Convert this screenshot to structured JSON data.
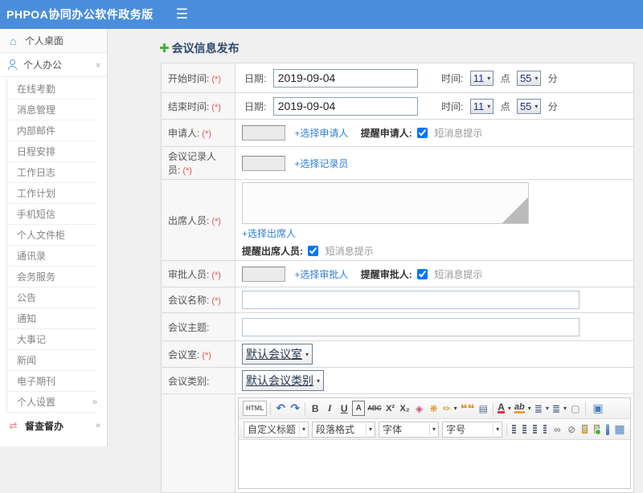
{
  "header": {
    "title": "PHPOA协同办公软件政务版"
  },
  "icons": {
    "menu": "☰",
    "home": "⌂",
    "chevron": "»",
    "plus": "✚",
    "shuffle": "⇄",
    "arrow": "▾"
  },
  "sidebar": {
    "desktop": "个人桌面",
    "office": "个人办公",
    "submenu": [
      "在线考勤",
      "消息管理",
      "内部邮件",
      "日程安排",
      "工作日志",
      "工作计划",
      "手机短信",
      "个人文件柜",
      "通讯录",
      "会务服务",
      "公告",
      "通知",
      "大事记",
      "新闻",
      "电子期刊"
    ],
    "settings": "个人设置",
    "supervision": "督查督办"
  },
  "page_title": "会议信息发布",
  "form": {
    "start_time": {
      "label": "开始时间:",
      "req": "(*)",
      "date_label": "日期:",
      "date": "2019-09-04",
      "time_label": "时间:",
      "hour": "11",
      "hour_unit": "点",
      "minute": "55",
      "minute_unit": "分"
    },
    "end_time": {
      "label": "结束时间:",
      "req": "(*)",
      "date_label": "日期:",
      "date": "2019-09-04",
      "time_label": "时间:",
      "hour": "11",
      "hour_unit": "点",
      "minute": "55",
      "minute_unit": "分"
    },
    "applicant": {
      "label": "申请人:",
      "req": "(*)",
      "link": "+选择申请人",
      "remind": "提醒申请人:",
      "sms": "短消息提示",
      "checked": "checked"
    },
    "recorder": {
      "label": "会议记录人员:",
      "req": "(*)",
      "link": "+选择记录员"
    },
    "attendees": {
      "label": "出席人员:",
      "req": "(*)",
      "link": "+选择出席人",
      "remind": "提醒出席人员:",
      "sms": "短消息提示",
      "checked": "checked"
    },
    "approver": {
      "label": "审批人员:",
      "req": "(*)",
      "link": "+选择审批人",
      "remind": "提醒审批人:",
      "sms": "短消息提示",
      "checked": "checked"
    },
    "name": {
      "label": "会议名称:",
      "req": "(*)"
    },
    "topic": {
      "label": "会议主题:"
    },
    "room": {
      "label": "会议室:",
      "req": "(*)",
      "value": "默认会议室"
    },
    "category": {
      "label": "会议类别:",
      "value": "默认会议类别"
    }
  },
  "editor": {
    "row1": [
      {
        "n": "html-source",
        "g": "HTML"
      },
      {
        "n": "undo",
        "g": "↶"
      },
      {
        "n": "redo",
        "g": "↷"
      },
      {
        "n": "bold",
        "g": "B"
      },
      {
        "n": "italic",
        "g": "I"
      },
      {
        "n": "underline",
        "g": "U"
      },
      {
        "n": "font-style",
        "g": "A"
      },
      {
        "n": "strikethrough",
        "g": "ABC"
      },
      {
        "n": "superscript",
        "g": "X²"
      },
      {
        "n": "subscript",
        "g": "X₂"
      },
      {
        "n": "eraser",
        "g": "◈"
      },
      {
        "n": "clean-format",
        "g": "❋"
      },
      {
        "n": "format-painter",
        "g": "✏"
      },
      {
        "n": "blockquote",
        "g": "❝❝"
      },
      {
        "n": "paste",
        "g": "▤"
      },
      {
        "n": "font-color",
        "g": "A"
      },
      {
        "n": "highlight",
        "g": "ab"
      },
      {
        "n": "ordered-list",
        "g": "≣"
      },
      {
        "n": "unordered-list",
        "g": "≣"
      },
      {
        "n": "new-page",
        "g": "▢"
      },
      {
        "n": "fullscreen",
        "g": "▣"
      }
    ],
    "combos": [
      "自定义标题",
      "段落格式",
      "字体",
      "字号"
    ],
    "row2": {
      "link": "∞",
      "unlink": "⊘",
      "table": "▦"
    }
  }
}
